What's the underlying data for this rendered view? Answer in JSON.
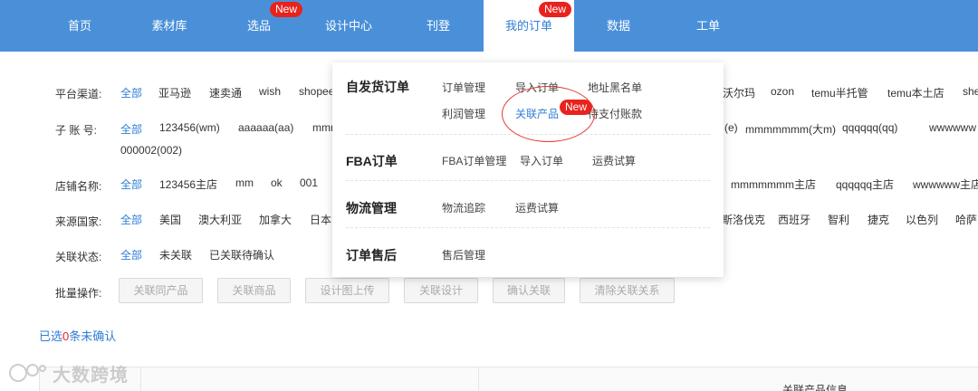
{
  "nav": {
    "items": [
      "首页",
      "素材库",
      "选品",
      "设计中心",
      "刊登",
      "我的订单",
      "数据",
      "工单"
    ],
    "badge_new": "New"
  },
  "filters": {
    "platform": {
      "label": "平台渠道:",
      "options": [
        "全部",
        "亚马逊",
        "速卖通",
        "wish",
        "shopee",
        "沃尔玛",
        "ozon",
        "temu半托管",
        "temu本土店",
        "she"
      ]
    },
    "subaccount": {
      "label": "子 账 号:",
      "options": [
        "全部",
        "123456(wm)",
        "aaaaaa(aa)",
        "mmr",
        "(e)",
        "mmmmmmm(大m)",
        "qqqqqq(qq)",
        "wwwwww",
        "000002(002)"
      ]
    },
    "shop": {
      "label": "店铺名称:",
      "options": [
        "全部",
        "123456主店",
        "mm",
        "ok",
        "001",
        "mmmmmmm主店",
        "qqqqqq主店",
        "wwwwww主店"
      ]
    },
    "country": {
      "label": "来源国家:",
      "options": [
        "全部",
        "美国",
        "澳大利亚",
        "加拿大",
        "日本",
        "斯洛伐克",
        "西班牙",
        "智利",
        "捷克",
        "以色列",
        "哈萨"
      ]
    },
    "link_status": {
      "label": "关联状态:",
      "options": [
        "全部",
        "未关联",
        "已关联待确认"
      ]
    },
    "batch": {
      "label": "批量操作:",
      "buttons": [
        "关联同产品",
        "关联商品",
        "设计图上传",
        "关联设计",
        "确认关联",
        "清除关联关系"
      ]
    }
  },
  "selected_summary": {
    "prefix": "已选",
    "count": "0",
    "suffix": "条未确认"
  },
  "watermark": "大数跨境",
  "table": {
    "header_label": "关联产品信息"
  },
  "dropdown": {
    "groups": [
      {
        "title": "自发货订单",
        "links": [
          "订单管理",
          "导入订单",
          "地址黑名单",
          "利润管理",
          "关联产品",
          "待支付账款"
        ]
      },
      {
        "title": "FBA订单",
        "links": [
          "FBA订单管理",
          "导入订单",
          "运费试算"
        ]
      },
      {
        "title": "物流管理",
        "links": [
          "物流追踪",
          "运费试算"
        ]
      },
      {
        "title": "订单售后",
        "links": [
          "售后管理"
        ]
      }
    ],
    "badge_new": "New"
  },
  "colors": {
    "nav_bg": "#4a90d9",
    "accent": "#2f7fd6",
    "badge": "#e8231e"
  }
}
